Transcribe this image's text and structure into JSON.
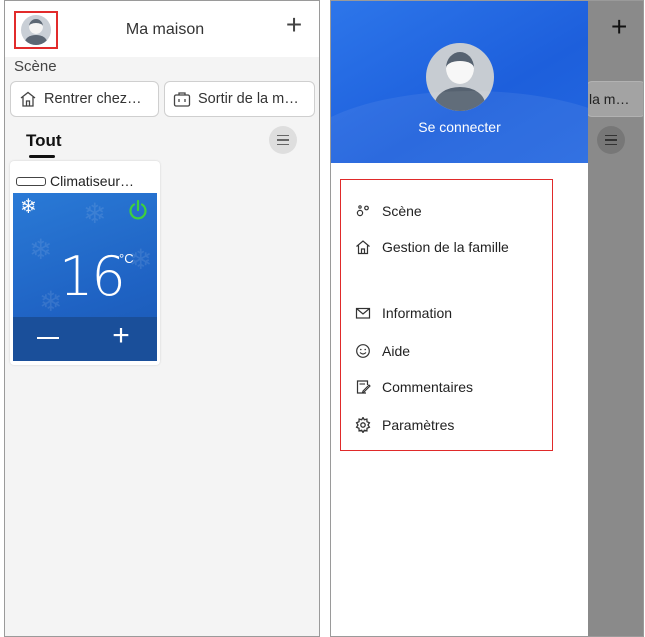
{
  "left_screen": {
    "header": {
      "title": "Ma maison",
      "add_icon": "plus-icon",
      "avatar_icon": "user-avatar-icon"
    },
    "scene": {
      "label": "Scène",
      "chips": [
        {
          "label": "Rentrer chez…",
          "icon": "home-icon"
        },
        {
          "label": "Sortir de la m…",
          "icon": "suitcase-icon"
        }
      ]
    },
    "tabs": {
      "all": "Tout",
      "menu_icon": "hamburger-icon"
    },
    "device": {
      "name": "Climatiseur…",
      "icon": "air-conditioner-icon",
      "mode_icon": "snowflake-icon",
      "power_icon": "power-icon",
      "temperature": "16",
      "unit": "°C",
      "minus_icon": "minus-icon",
      "plus_icon": "plus-icon",
      "power_color": "#3ecf3e",
      "panel_color": "#2a7ad6"
    }
  },
  "right_screen": {
    "background": {
      "chip_label": "la m…",
      "plus_icon": "plus-icon",
      "menu_icon": "hamburger-icon"
    },
    "drawer": {
      "login": "Se connecter",
      "header_color": "#2468e0",
      "items": [
        {
          "label": "Scène",
          "icon": "scene-dots-icon"
        },
        {
          "label": "Gestion de la famille",
          "icon": "home-icon"
        },
        {
          "label": "Information",
          "icon": "mail-icon"
        },
        {
          "label": "Aide",
          "icon": "smiley-icon"
        },
        {
          "label": "Commentaires",
          "icon": "edit-note-icon"
        },
        {
          "label": "Paramètres",
          "icon": "gear-icon"
        }
      ]
    }
  }
}
